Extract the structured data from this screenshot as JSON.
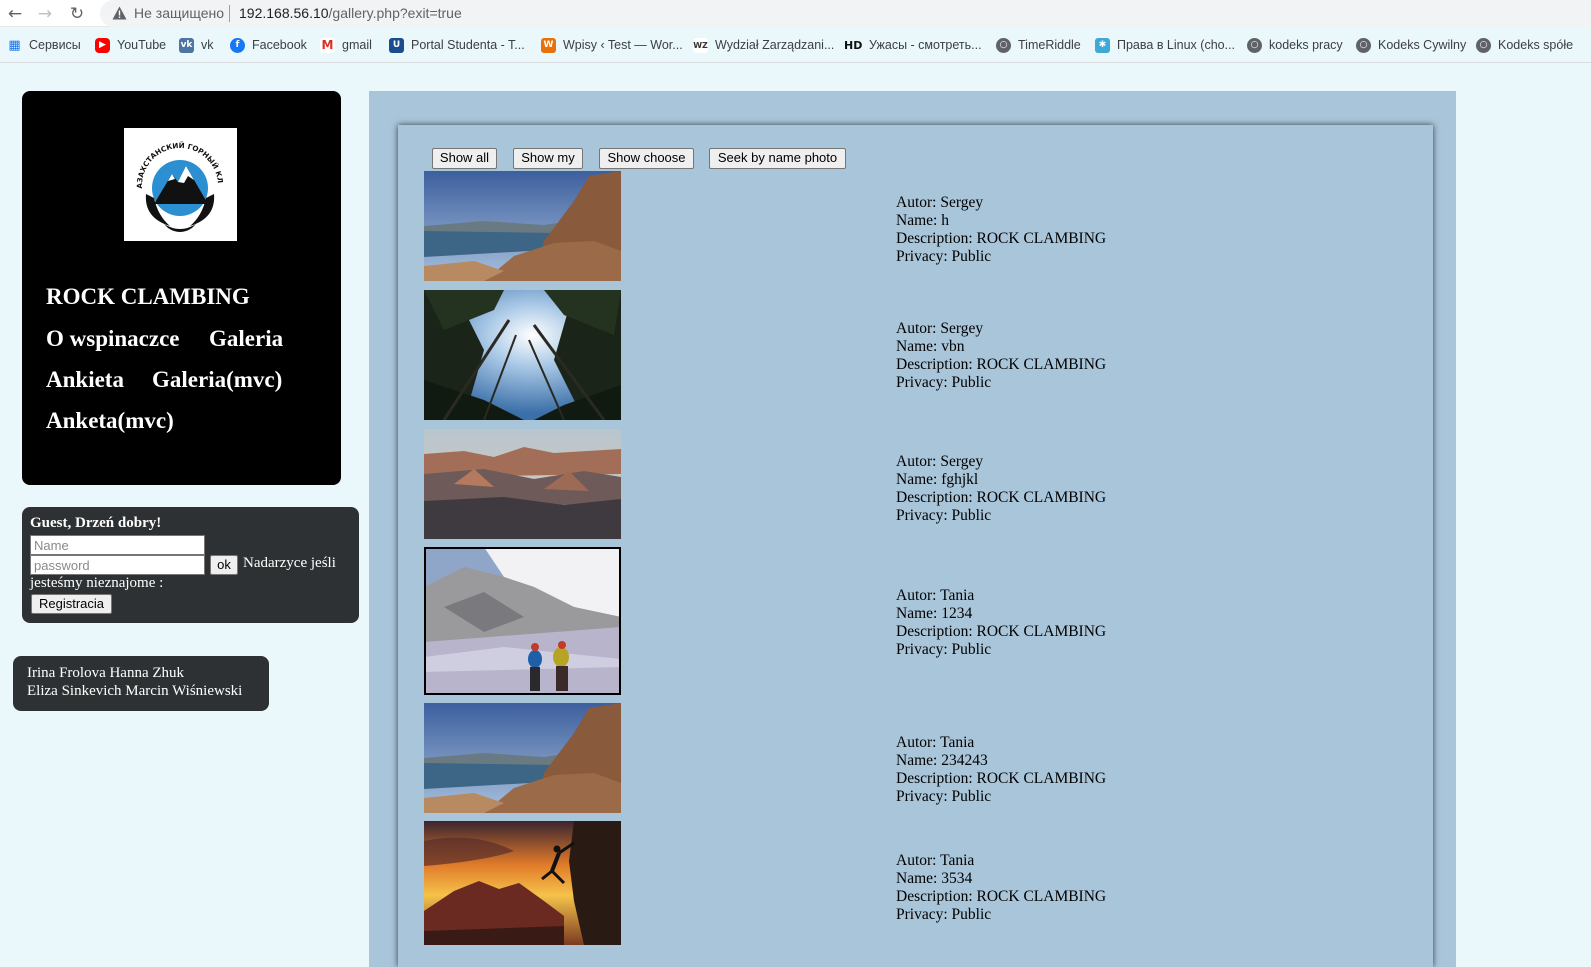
{
  "browser": {
    "security_label": "Не защищено",
    "url_host": "192.168.56.10",
    "url_path": "/gallery.php?exit=true",
    "bookmarks": [
      {
        "label": "Сервисы",
        "icon": "apps-grid-icon"
      },
      {
        "label": "YouTube",
        "icon": "youtube-icon"
      },
      {
        "label": "vk",
        "icon": "vk-icon"
      },
      {
        "label": "Facebook",
        "icon": "facebook-icon"
      },
      {
        "label": "gmail",
        "icon": "gmail-icon"
      },
      {
        "label": "Portal Studenta - T...",
        "icon": "portal-icon"
      },
      {
        "label": "Wpisy ‹ Test — Wor...",
        "icon": "wordpress-icon"
      },
      {
        "label": "Wydział Zarządzani...",
        "icon": "wz-icon"
      },
      {
        "label": "Ужасы - смотреть...",
        "icon": "hd-icon"
      },
      {
        "label": "TimeRiddle",
        "icon": "globe-icon"
      },
      {
        "label": "Права в Linux (cho...",
        "icon": "linux-icon"
      },
      {
        "label": "kodeks pracy",
        "icon": "globe-icon"
      },
      {
        "label": "Kodeks Cywilny",
        "icon": "globe-icon"
      },
      {
        "label": "Kodeks spółe",
        "icon": "globe-icon"
      }
    ]
  },
  "sidebar": {
    "title": "ROCK CLAMBING",
    "logo_text": "КАЗАХСТАНСКИЙ ГОРНЫЙ КЛУБ",
    "menu": [
      "O wspinaczce",
      "Galeria",
      "Ankieta",
      "Galeria(mvc)",
      "Anketa(mvc)"
    ],
    "login": {
      "greeting": "Guest, Drzeń dobry!",
      "name_placeholder": "Name",
      "password_placeholder": "password",
      "ok_label": "ok",
      "note_line1": "Nadarzyce jeśli",
      "note_line2": "jesteśmy nieznajome :",
      "register_label": "Registracia"
    },
    "authors": [
      "Irina Frolova Hanna Zhuk",
      "Eliza Sinkevich Marcin Wiśniewski"
    ]
  },
  "toolbar": {
    "show_all": "Show all",
    "show_my": "Show my",
    "show_choose": "Show choose",
    "seek_by_name": "Seek by name photo"
  },
  "photo_labels": {
    "author": "Autor: ",
    "name": "Name: ",
    "description": "Description: ",
    "privacy": "Privacy: "
  },
  "photos": [
    {
      "author": "Sergey",
      "name": "h",
      "description": "ROCK CLAMBING",
      "privacy": "Public",
      "scene": "lake-cliff"
    },
    {
      "author": "Sergey",
      "name": "vbn",
      "description": "ROCK CLAMBING",
      "privacy": "Public",
      "scene": "forest-sky"
    },
    {
      "author": "Sergey",
      "name": "fghjkl",
      "description": "ROCK CLAMBING",
      "privacy": "Public",
      "scene": "canyon"
    },
    {
      "author": "Tania",
      "name": "1234",
      "description": "ROCK CLAMBING",
      "privacy": "Public",
      "scene": "glacier-climbers"
    },
    {
      "author": "Tania",
      "name": "234243",
      "description": "ROCK CLAMBING",
      "privacy": "Public",
      "scene": "lake-cliff"
    },
    {
      "author": "Tania",
      "name": "3534",
      "description": "ROCK CLAMBING",
      "privacy": "Public",
      "scene": "sunset-climber"
    }
  ],
  "colors": {
    "page_bg": "#eaf7fb",
    "content_bg": "#a9c5da",
    "menu_bg": "#000000",
    "box_bg": "#2e3133"
  }
}
